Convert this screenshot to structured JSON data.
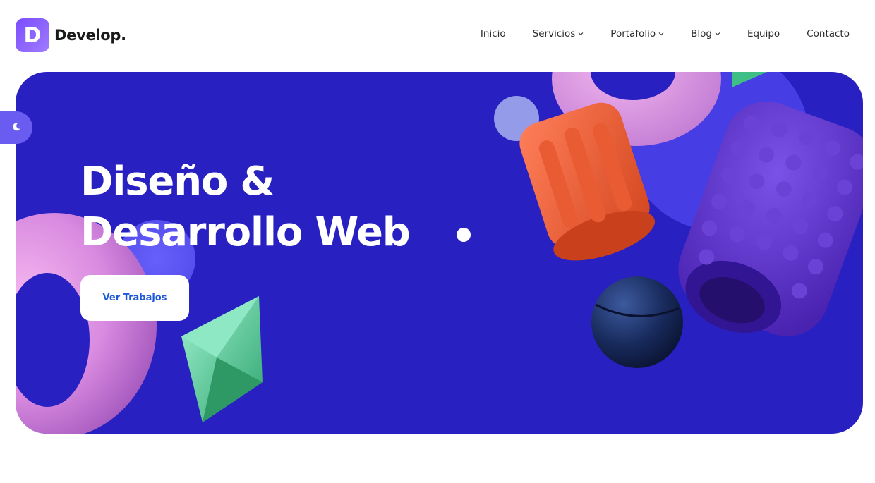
{
  "brand": {
    "mark": "D",
    "name": "Develop.",
    "accent": "#7a4dff"
  },
  "nav": {
    "items": [
      {
        "label": "Inicio",
        "dropdown": false
      },
      {
        "label": "Servicios",
        "dropdown": true
      },
      {
        "label": "Portafolio",
        "dropdown": true
      },
      {
        "label": "Blog",
        "dropdown": true
      },
      {
        "label": "Equipo",
        "dropdown": false
      },
      {
        "label": "Contacto",
        "dropdown": false
      }
    ]
  },
  "hero": {
    "title_line1": "Diseño &",
    "title_line2": "Desarrollo Web",
    "cta_label": "Ver Trabajos",
    "background": "#2920c2"
  },
  "theme_toggle": {
    "icon": "moon-icon"
  }
}
